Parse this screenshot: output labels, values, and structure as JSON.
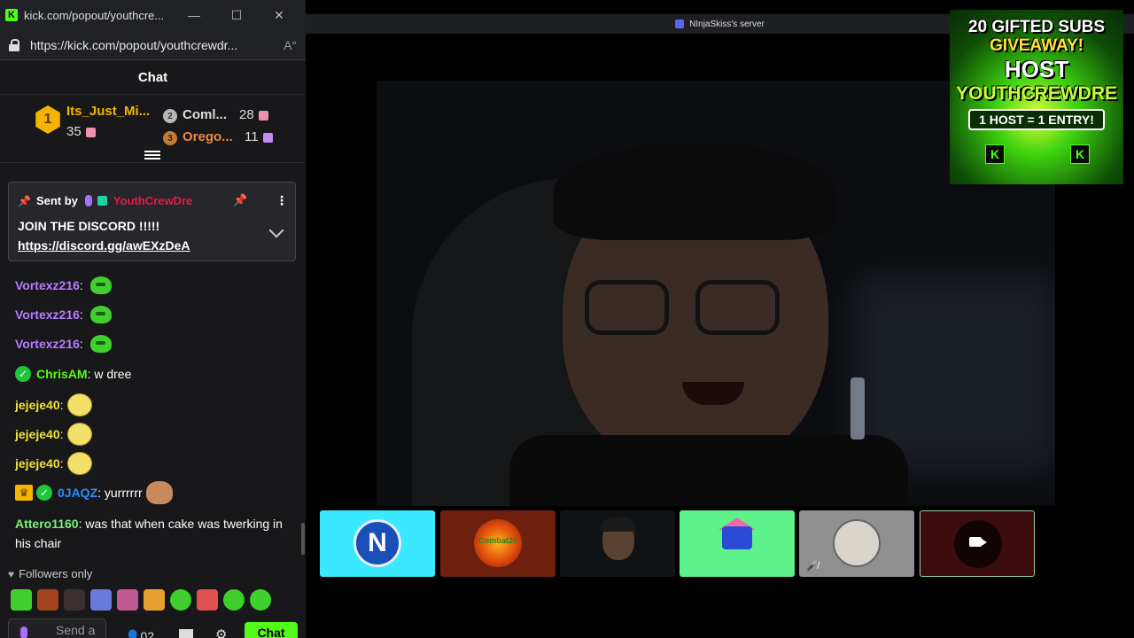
{
  "window": {
    "title": "kick.com/popout/youthcre...",
    "url": "https://kick.com/popout/youthcrewdr...",
    "minimize": "—",
    "maximize": "☐",
    "close": "✕"
  },
  "chat": {
    "header": "Chat",
    "leaderboard": {
      "first": {
        "rank": "1",
        "name": "Its_Just_Mi...",
        "count": "35"
      },
      "second": {
        "rank": "2",
        "name": "Coml...",
        "count": "28"
      },
      "third": {
        "rank": "3",
        "name": "Orego...",
        "count": "11"
      }
    },
    "pinned": {
      "sent_by_label": "Sent by",
      "username": "YouthCrewDre",
      "text": "JOIN THE DISCORD !!!!!",
      "link": "https://discord.gg/awEXzDeA"
    },
    "messages": [
      {
        "user": "Vortexz216",
        "text": ""
      },
      {
        "user": "Vortexz216",
        "text": ""
      },
      {
        "user": "Vortexz216",
        "text": ""
      },
      {
        "user": "ChrisAM",
        "text": " w dree"
      },
      {
        "user": "jejeje40",
        "text": ""
      },
      {
        "user": "jejeje40",
        "text": ""
      },
      {
        "user": "jejeje40",
        "text": ""
      },
      {
        "user": "0JAQZ",
        "text": " yurrrrrr"
      },
      {
        "user": "Attero1160",
        "text": " was that when cake was twerking in his chair"
      }
    ],
    "followers_only": "Followers only",
    "input_placeholder": "Send a",
    "users_count": "02",
    "send_button": "Chat"
  },
  "discord": {
    "server_title": "NInjaSkiss's server"
  },
  "overlay": {
    "line1": "20 GIFTED SUBS",
    "line2": "GIVEAWAY!",
    "host": "HOST",
    "name": "YOUTHCREWDRE",
    "entry": "1 HOST = 1 ENTRY!",
    "k_left": "K",
    "k_right": "K"
  },
  "tiles": {
    "tile1_initial": "N",
    "tile2_text": "Combat20"
  }
}
